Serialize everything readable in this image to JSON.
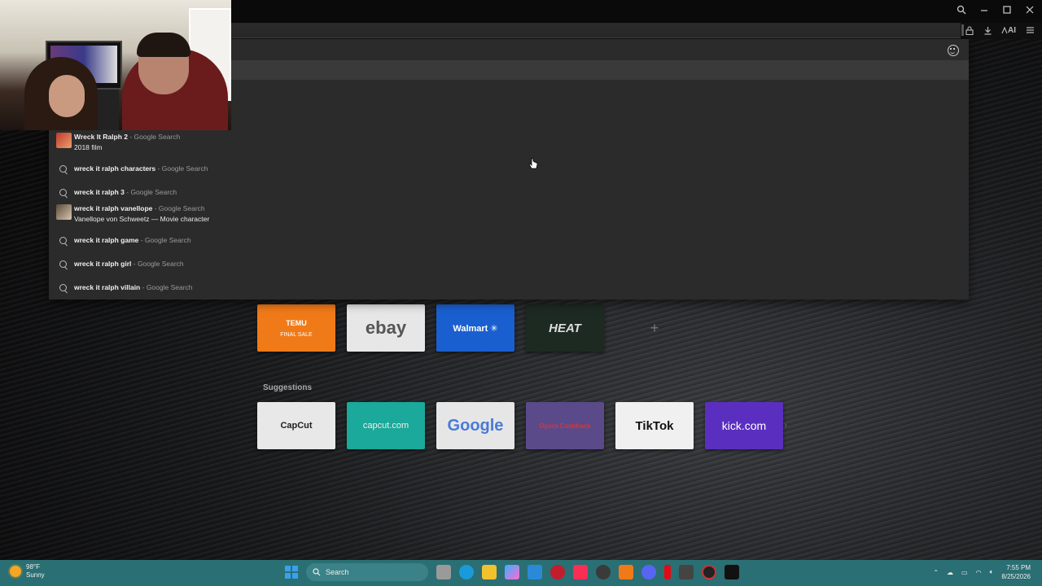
{
  "browser": {
    "toolbar_ai_label": "AI",
    "icons": [
      "search-icon",
      "minimize-icon",
      "maximize-icon",
      "close-icon",
      "lock-icon",
      "download-icon",
      "ai-icon",
      "menu-icon",
      "emoji-icon"
    ]
  },
  "dropdown": {
    "suggestions": [
      {
        "main": "Wreck It Ralph 2",
        "sep": " - Google Search",
        "sub": "2018 film",
        "icon": "thumbnail"
      },
      {
        "main": "wreck it ralph characters",
        "sep": " - Google Search",
        "sub": "",
        "icon": "search-icon"
      },
      {
        "main": "wreck it ralph 3",
        "sep": " - Google Search",
        "sub": "",
        "icon": "search-icon"
      },
      {
        "main": "wreck it ralph vanellope",
        "sep": " - Google Search",
        "sub": "Vanellope von Schweetz — Movie character",
        "icon": "thumbnail"
      },
      {
        "main": "wreck it ralph game",
        "sep": " - Google Search",
        "sub": "",
        "icon": "search-icon"
      },
      {
        "main": "wreck it ralph girl",
        "sep": " - Google Search",
        "sub": "",
        "icon": "search-icon"
      },
      {
        "main": "wreck it ralph villain",
        "sep": " - Google Search",
        "sub": "",
        "icon": "search-icon"
      }
    ]
  },
  "speed_dial": {
    "top_row": [
      {
        "label": "TEMU",
        "sub": "FINAL SALE"
      },
      {
        "label": "ebay"
      },
      {
        "label": "Walmart ✳"
      },
      {
        "label": "HEAT"
      },
      {
        "label": "+"
      }
    ],
    "suggestions_heading": "Suggestions",
    "suggestions_row": [
      {
        "label": "CapCut"
      },
      {
        "label": "capcut.com"
      },
      {
        "label": "Google"
      },
      {
        "label": "Opera Cashback"
      },
      {
        "label": "TikTok"
      },
      {
        "label": "kick.com"
      }
    ]
  },
  "taskbar": {
    "weather_temp": "98°F",
    "weather_cond": "Sunny",
    "search_placeholder": "Search",
    "time": "7:55 PM",
    "date": "8/25/2026"
  }
}
